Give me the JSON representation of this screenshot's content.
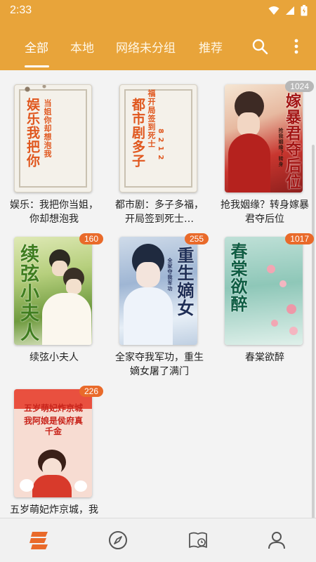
{
  "status_bar": {
    "time": "2:33"
  },
  "tabs": [
    {
      "label": "全部",
      "active": true
    },
    {
      "label": "本地",
      "active": false
    },
    {
      "label": "网络未分组",
      "active": false
    },
    {
      "label": "推荐",
      "active": false
    }
  ],
  "icons": {
    "search": "search-icon",
    "more": "more-vert-icon"
  },
  "colors": {
    "accent": "#e8a43a",
    "badge": "#e96a2a",
    "badge_muted": "#b7b7b7",
    "nav_active": "#e96a2a"
  },
  "books": [
    {
      "title": "娱乐：我把你当姐，你却想泡我",
      "cover_main": "娱乐我把你",
      "cover_sub": "当姐你却想泡我",
      "badge": ""
    },
    {
      "title": "都市剧：多子多福，开局签到死士…",
      "cover_main": "都市剧多子",
      "cover_sub": "福开局签到死士",
      "cover_num": "8 2 1 2",
      "badge": ""
    },
    {
      "title": "抢我姻缘？转身嫁暴君夺后位",
      "cover_main": "嫁暴君夺后位",
      "cover_sub": "抢我姻缘？转身",
      "badge": "1024"
    },
    {
      "title": "续弦小夫人",
      "cover_main": "续弦小夫人",
      "badge": "160"
    },
    {
      "title": "全家夺我军功，重生嫡女屠了满门",
      "cover_main": "重生嫡女",
      "cover_sub": "全家夺我军功",
      "badge": "255"
    },
    {
      "title": "春棠欲醉",
      "cover_main": "春棠欲醉",
      "badge": "1017"
    },
    {
      "title": "五岁萌妃炸京城，我阿娘是侯府真千…",
      "cover_main": "五岁萌妃炸京城",
      "cover_sub": "我阿娘是侯府真千金",
      "badge": "226"
    }
  ],
  "bottom_nav": [
    {
      "name": "bookshelf",
      "icon": "bookshelf-icon",
      "active": true
    },
    {
      "name": "discover",
      "icon": "compass-icon",
      "active": false
    },
    {
      "name": "rss",
      "icon": "book-clock-icon",
      "active": false
    },
    {
      "name": "my",
      "icon": "person-icon",
      "active": false
    }
  ]
}
